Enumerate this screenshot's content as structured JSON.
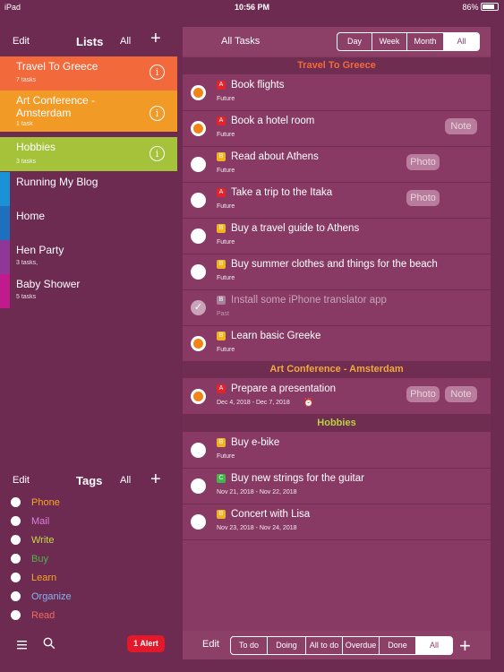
{
  "status": {
    "device": "iPad",
    "time": "10:56 PM",
    "battery": "86%"
  },
  "lists_panel": {
    "edit": "Edit",
    "title": "Lists",
    "all": "All",
    "add": "+",
    "items": [
      {
        "name": "Travel To Greece",
        "sub": "7 tasks",
        "color": "#f26a3c",
        "info": "i"
      },
      {
        "name": "Art Conference - Amsterdam",
        "sub": "1 task",
        "color": "#f29a26",
        "info": "i"
      },
      {
        "name": "Hobbies",
        "sub": "3 tasks",
        "color": "#a4c33a",
        "info": "i"
      },
      {
        "name": "Running My Blog",
        "sub": "",
        "color": "#1a92d7"
      },
      {
        "name": "Home",
        "sub": "",
        "color": "#1f6fbf"
      },
      {
        "name": "Hen Party",
        "sub": "3 tasks,",
        "color": "#913699"
      },
      {
        "name": "Baby Shower",
        "sub": "5 tasks",
        "color": "#c01a8d"
      }
    ]
  },
  "tags_panel": {
    "edit": "Edit",
    "title": "Tags",
    "all": "All",
    "add": "+",
    "items": [
      {
        "name": "Phone",
        "color": "#f5a623"
      },
      {
        "name": "Mail",
        "color": "#e07fe0"
      },
      {
        "name": "Write",
        "color": "#c2d94a"
      },
      {
        "name": "Buy",
        "color": "#4ab54a"
      },
      {
        "name": "Learn",
        "color": "#f5a623"
      },
      {
        "name": "Organize",
        "color": "#7fb6f2"
      },
      {
        "name": "Read",
        "color": "#f06a5a"
      }
    ]
  },
  "sidebar_bottom": {
    "menu_icon": "menu-icon",
    "search_icon": "search-icon",
    "alert": "1 Alert"
  },
  "main": {
    "title": "All Tasks",
    "range_tabs": [
      "Day",
      "Week",
      "Month",
      "All"
    ],
    "range_selected": "All",
    "sections": [
      {
        "title": "Travel To Greece",
        "color": "#f26a3c",
        "tasks": [
          {
            "prio": "A",
            "name": "Book flights",
            "date": "Future",
            "state": "orange"
          },
          {
            "prio": "A",
            "name": "Book a hotel room",
            "date": "Future",
            "state": "orange",
            "note": "Note"
          },
          {
            "prio": "B",
            "name": "Read about Athens",
            "date": "Future",
            "state": "open",
            "photo": "Photo"
          },
          {
            "prio": "A",
            "name": "Take a trip to the Itaka",
            "date": "Future",
            "state": "open",
            "photo": "Photo"
          },
          {
            "prio": "B",
            "name": "Buy a travel guide to Athens",
            "date": "Future",
            "state": "open"
          },
          {
            "prio": "B",
            "name": "Buy summer clothes and things for the beach",
            "date": "Future",
            "state": "open"
          },
          {
            "prio": "B",
            "name": "Install some iPhone translator app",
            "date": "Past",
            "state": "done"
          },
          {
            "prio": "B",
            "name": "Learn basic Greeke",
            "date": "Future",
            "state": "orange"
          }
        ]
      },
      {
        "title": "Art Conference - Amsterdam",
        "color": "#f2a93b",
        "tasks": [
          {
            "prio": "A",
            "name": "Prepare a presentation",
            "date": "Dec 4, 2018 - Dec 7, 2018",
            "state": "orange",
            "photo": "Photo",
            "note": "Note",
            "alarm": "⏰"
          }
        ]
      },
      {
        "title": "Hobbies",
        "color": "#b9d33f",
        "tasks": [
          {
            "prio": "B",
            "name": "Buy e-bike",
            "date": "Future",
            "state": "open"
          },
          {
            "prio": "C",
            "name": "Buy new strings for the guitar",
            "date": "Nov 21, 2018 - Nov 22, 2018",
            "state": "open"
          },
          {
            "prio": "B",
            "name": "Concert with Lisa",
            "date": "Nov 23, 2018 - Nov 24, 2018",
            "state": "open"
          }
        ]
      }
    ],
    "bottom": {
      "edit": "Edit",
      "filters": [
        "To do",
        "Doing",
        "All to do",
        "Overdue",
        "Done",
        "All"
      ],
      "filter_selected": "All",
      "add": "+"
    }
  }
}
